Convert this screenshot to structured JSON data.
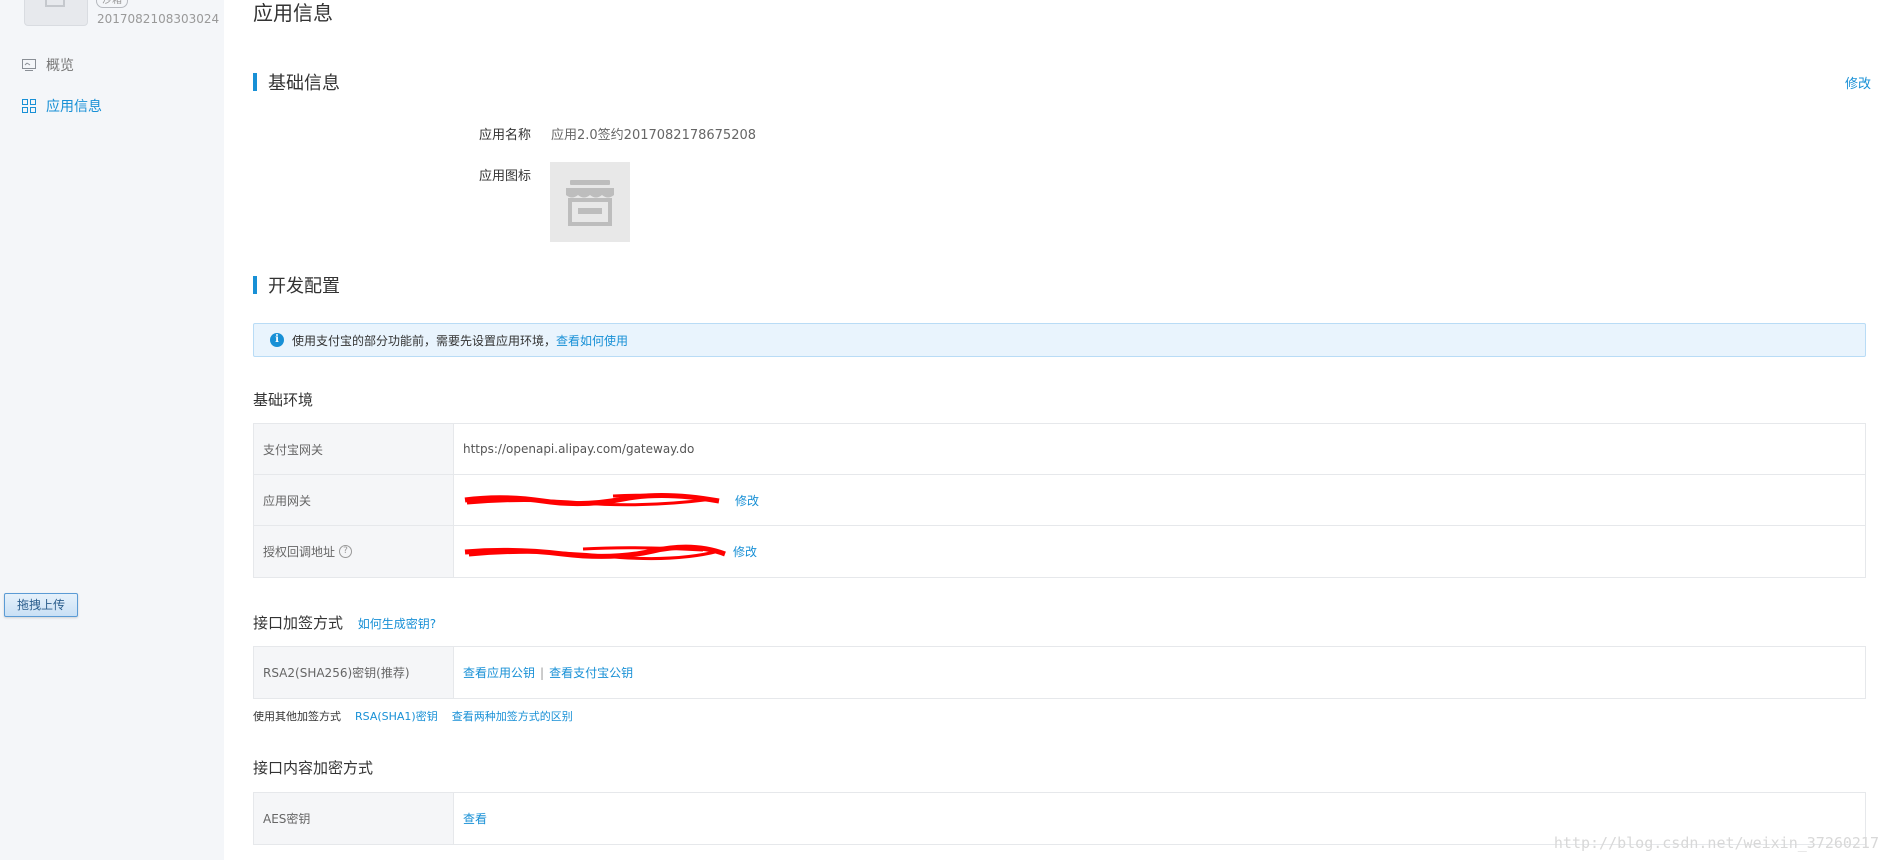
{
  "sidebar": {
    "env_badge": "沙箱",
    "app_id": "2017082108303024",
    "nav": [
      {
        "label": "概览",
        "icon": "monitor-icon",
        "active": false
      },
      {
        "label": "应用信息",
        "icon": "grid-icon",
        "active": true
      }
    ],
    "upload_button": "拖拽上传"
  },
  "page_title": "应用信息",
  "basic_info": {
    "section_title": "基础信息",
    "edit_label": "修改",
    "name_label": "应用名称",
    "name_value": "应用2.0签约2017082178675208",
    "icon_label": "应用图标"
  },
  "dev_config": {
    "section_title": "开发配置",
    "notice_text": "使用支付宝的部分功能前，需要先设置应用环境，",
    "notice_link": "查看如何使用"
  },
  "basic_env": {
    "title": "基础环境",
    "rows": [
      {
        "key": "支付宝网关",
        "value": "https://openapi.alipay.com/gateway.do"
      },
      {
        "key": "应用网关",
        "action": "修改"
      },
      {
        "key": "授权回调地址",
        "action": "修改"
      }
    ]
  },
  "signing": {
    "title": "接口加签方式",
    "title_link": "如何生成密钥?",
    "row_key": "RSA2(SHA256)密钥(推荐)",
    "link1": "查看应用公钥",
    "separator": "|",
    "link2": "查看支付宝公钥",
    "alt_label": "使用其他加签方式",
    "alt_link1": "RSA(SHA1)密钥",
    "alt_link2": "查看两种加签方式的区别"
  },
  "encryption": {
    "title": "接口内容加密方式",
    "row_key": "AES密钥",
    "row_link": "查看"
  },
  "watermark": "http://blog.csdn.net/weixin_37260217",
  "colors": {
    "accent": "#1890d6",
    "sidebar_bg": "#f4f6f9",
    "scribble": "#ff0000"
  }
}
